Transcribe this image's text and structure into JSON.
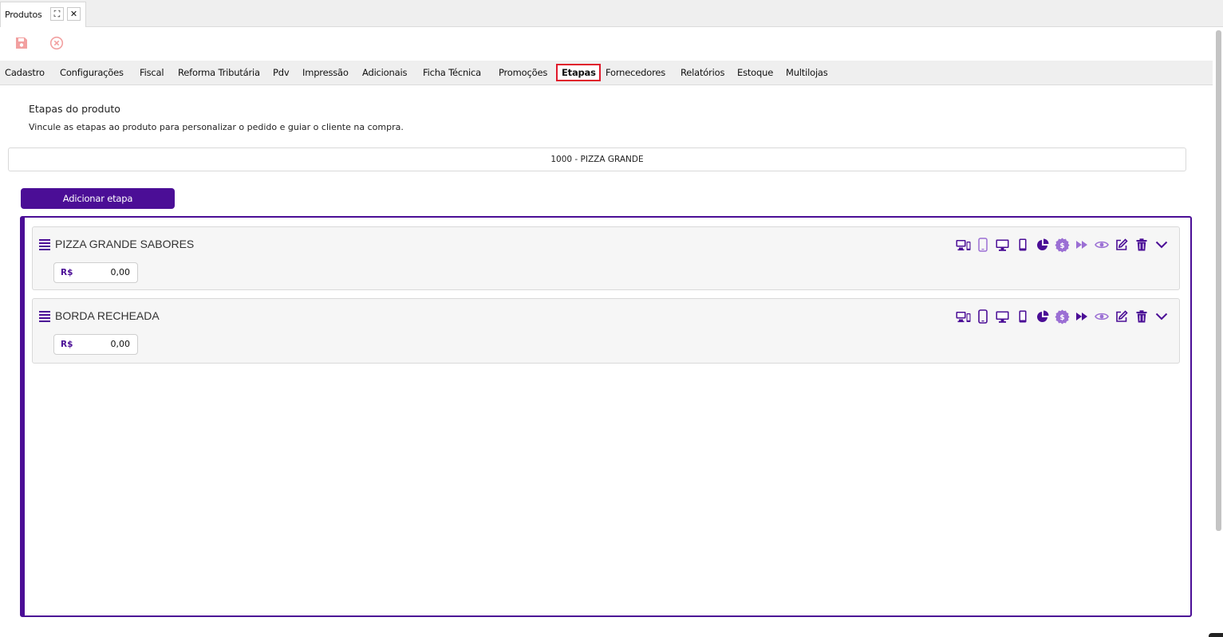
{
  "tab": {
    "title": "Produtos",
    "maximize_glyph": "⛶",
    "close_glyph": "✕"
  },
  "toolbar": {
    "save_icon": "save-icon",
    "cancel_icon": "cancel-circle-icon"
  },
  "nav": {
    "items": [
      "Cadastro",
      "Configurações",
      "Fiscal",
      "Reforma Tributária",
      "Pdv",
      "Impressão",
      "Adicionais",
      "Ficha Técnica",
      "Promoções",
      "Etapas",
      "Fornecedores",
      "Relatórios",
      "Estoque",
      "Multilojas"
    ],
    "active": "Etapas"
  },
  "main": {
    "title": "Etapas do produto",
    "description": "Vincule as etapas ao produto para personalizar o pedido e guiar o cliente na compra.",
    "product": "1000 - PIZZA GRANDE",
    "add_button": "Adicionar etapa"
  },
  "steps": [
    {
      "name": "PIZZA GRANDE SABORES",
      "currency": "R$",
      "price": "0,00"
    },
    {
      "name": "BORDA RECHEADA",
      "currency": "R$",
      "price": "0,00"
    }
  ],
  "colors": {
    "accent": "#4b0e96",
    "accent_light": "#9b6fd4",
    "active_tab_border": "#e0182b",
    "toolbar_icon": "#f2a0a0"
  }
}
